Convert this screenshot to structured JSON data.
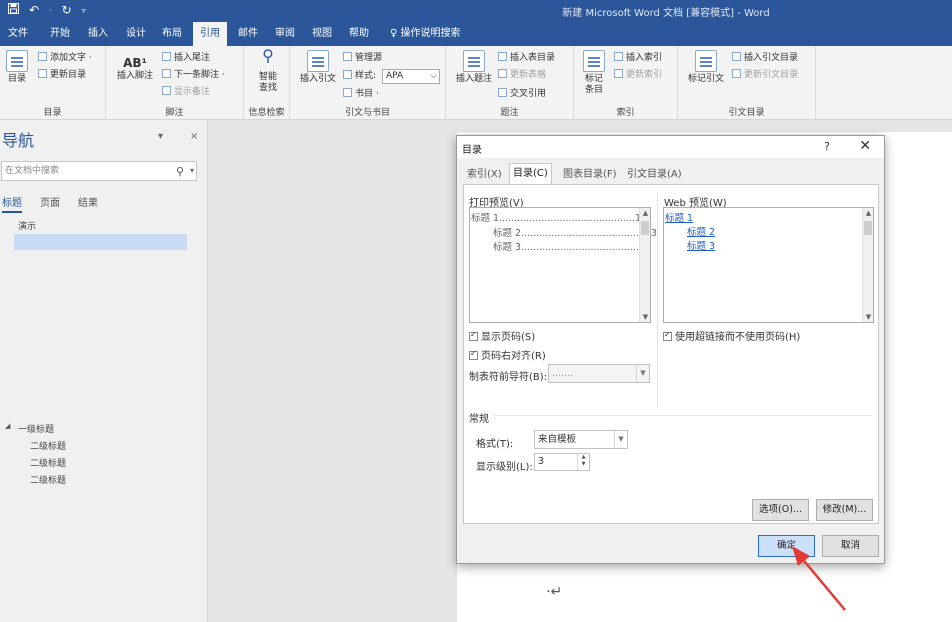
{
  "window": {
    "title": "新建 Microsoft Word 文档 [兼容模式] - Word"
  },
  "qat": {
    "save_icon": "save-icon",
    "undo_icon": "undo-icon",
    "redo_icon": "redo-icon",
    "customize_icon": "customize-qat-icon"
  },
  "menu": {
    "tabs": [
      "文件",
      "开始",
      "插入",
      "设计",
      "布局",
      "引用",
      "邮件",
      "审阅",
      "视图",
      "帮助"
    ],
    "active": "引用",
    "tell_me": "操作说明搜索"
  },
  "ribbon": {
    "toc_group": {
      "toc_button": "目录",
      "add_text": "添加文字 ·",
      "update_toc": "更新目录",
      "label": "目录"
    },
    "footnote_group": {
      "insert_footnote": "插入脚注",
      "ab_glyph": "AB¹",
      "insert_endnote": "插入尾注",
      "next_footnote": "下一条脚注 ·",
      "show_notes": "显示备注",
      "label": "脚注"
    },
    "research_group": {
      "smart_lookup": "智能\n查找",
      "label": "信息检索"
    },
    "citations_group": {
      "insert_citation": "插入引文",
      "manage_sources": "管理源",
      "style_label": "样式:",
      "style_value": "APA",
      "bibliography": "书目 ·",
      "label": "引文与书目"
    },
    "captions_group": {
      "insert_caption": "插入题注",
      "insert_tof": "插入表目录",
      "update_table": "更新表格",
      "cross_reference": "交叉引用",
      "label": "题注"
    },
    "index_group": {
      "mark_entry": "标记\n条目",
      "insert_index": "插入索引",
      "update_index": "更新索引",
      "label": "索引"
    },
    "toa_group": {
      "mark_citation": "标记引文",
      "insert_toa": "插入引文目录",
      "update_toa": "更新引文目录",
      "label": "引文目录"
    }
  },
  "nav": {
    "title": "导航",
    "search_placeholder": "在文档中搜索",
    "tabs": [
      "标题",
      "页面",
      "结果"
    ],
    "active_tab": "标题",
    "items": [
      {
        "text": "演示",
        "level": 2
      },
      {
        "text": "一级标题",
        "level": 1
      },
      {
        "text": "二级标题",
        "level": 2
      },
      {
        "text": "二级标题",
        "level": 2
      },
      {
        "text": "二级标题",
        "level": 2
      }
    ]
  },
  "dialog": {
    "title": "目录",
    "help": "?",
    "close": "✕",
    "tabs": [
      "索引(X)",
      "目录(C)",
      "图表目录(F)",
      "引文目录(A)"
    ],
    "active_tab": "目录(C)",
    "print_preview_label": "打印预览(V)",
    "print_preview": [
      {
        "text": "标题 1.............................................1",
        "level": 1
      },
      {
        "text": "标题 2...........................................3",
        "level": 2
      },
      {
        "text": "标题 3.........................................5",
        "level": 3
      }
    ],
    "web_preview_label": "Web 预览(W)",
    "web_preview": [
      "标题 1",
      "标题 2",
      "标题 3"
    ],
    "show_page_numbers": "显示页码(S)",
    "right_align": "页码右对齐(R)",
    "use_hyperlinks": "使用超链接而不使用页码(H)",
    "tab_leader_label": "制表符前导符(B):",
    "tab_leader_value": ".......",
    "general_label": "常规",
    "format_label": "格式(T):",
    "format_value": "来自模板",
    "levels_label": "显示级别(L):",
    "levels_value": "3",
    "options_button": "选项(O)...",
    "modify_button": "修改(M)...",
    "ok_button": "确定",
    "cancel_button": "取消"
  },
  "colors": {
    "brand": "#2b579a",
    "annotation": "#e53935",
    "link": "#1a5fc9"
  }
}
